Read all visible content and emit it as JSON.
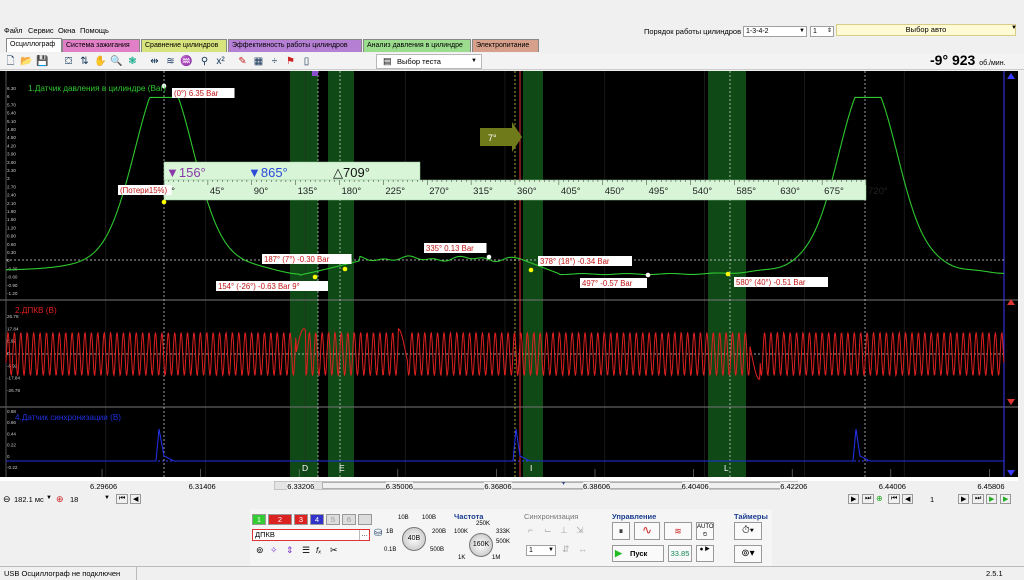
{
  "menu": [
    "Файл",
    "Сервис",
    "Окна",
    "Помощь"
  ],
  "cylinder_order": {
    "label": "Порядок работы цилиндров",
    "value": "1-3-4-2",
    "cylinder": "1"
  },
  "auto_button": "Выбор авто",
  "tabs": [
    {
      "label": "Осциллограф",
      "color": "#ffffff",
      "active": true
    },
    {
      "label": "Система зажигания",
      "color": "#e17fc7"
    },
    {
      "label": "Сравнение цилиндров",
      "color": "#d7e37c"
    },
    {
      "label": "Эффективность работы цилиндров",
      "color": "#b57fd4"
    },
    {
      "label": "Анализ давления в цилиндре",
      "color": "#9bdc8e"
    },
    {
      "label": "Электропитание",
      "color": "#d7a08b"
    }
  ],
  "toolbar": {
    "test_button": "Выбор теста"
  },
  "rpm": {
    "angle": "-9°",
    "value": "923",
    "unit": "об./мин."
  },
  "scope": {
    "ch1": {
      "label": "1.Датчик давления в цилиндре (Bar)",
      "color": "#2ec82e",
      "ticks": [
        "6.30",
        "6",
        "5.70",
        "5.40",
        "5.10",
        "4.80",
        "4.50",
        "4.20",
        "3.90",
        "3.60",
        "3.30",
        "3",
        "2.70",
        "2.40",
        "2.10",
        "1.80",
        "1.50",
        "1.20",
        "0.90",
        "0.60",
        "0.30",
        "0",
        "-0.30",
        "-0.60",
        "-0.90",
        "-1.20"
      ]
    },
    "ch2": {
      "label": "2.ДПКВ (B)",
      "color": "#e02020",
      "ticks": [
        "26.78",
        "17.84",
        "8.92",
        "0",
        "-8.92",
        "-17.84",
        "-26.78"
      ]
    },
    "ch4": {
      "label": "4.Датчик синхронизации (B)",
      "color": "#1f2fe0",
      "ticks": [
        "0.88",
        "0.66",
        "0.44",
        "0.22",
        "0",
        "-0.22"
      ]
    },
    "time_ticks": [
      "6.29606",
      "6.31406",
      "6.33206",
      "6.35006",
      "6.36806",
      "6.38606",
      "6.40406",
      "6.42206",
      "6.44006",
      "6.45806"
    ],
    "markers": {
      "m1": "156°",
      "m2": "865°",
      "delta": "709°"
    },
    "degree_ticks": [
      "0°",
      "45°",
      "90°",
      "135°",
      "180°",
      "225°",
      "270°",
      "315°",
      "360°",
      "405°",
      "450°",
      "495°",
      "540°",
      "585°",
      "630°",
      "675°",
      "720°"
    ],
    "timing_badge": "7°",
    "zone_labels": [
      "D",
      "E",
      "I",
      "L"
    ],
    "annotations": [
      "(0°) 6.35 Bar",
      "(Потери15%)",
      "187° (7°) -0.30 Bar",
      "154° (-26°) -0.63 Bar 9°",
      "335° 0.13 Bar",
      "378° (18°) -0.34 Bar",
      "497° -0.57 Bar",
      "580° (40°) -0.51 Bar"
    ]
  },
  "bottom_nav": {
    "timebase": "182.1 мс",
    "div": "18",
    "page": "1"
  },
  "control": {
    "cylinder_buttons": [
      "1",
      "2",
      "3",
      "4",
      "5",
      "6"
    ],
    "channel_name": "ДПКВ",
    "volt_knob": {
      "labels": [
        "10В",
        "100В",
        "1В",
        "200В",
        "0.1В",
        "500В"
      ],
      "value": "40В"
    },
    "freq": {
      "title": "Частота",
      "labels": [
        "100K",
        "250K",
        "333K",
        "500K",
        "1K",
        "1M"
      ],
      "value": "160K"
    },
    "sync": {
      "title": "Синхронизация",
      "value": "1"
    },
    "manage": {
      "title": "Управление",
      "start": "Пуск",
      "value": "33.85"
    },
    "timers": {
      "title": "Таймеры"
    }
  },
  "status": {
    "connection": "USB Осциллограф не подключен",
    "version": "2.5.1"
  }
}
